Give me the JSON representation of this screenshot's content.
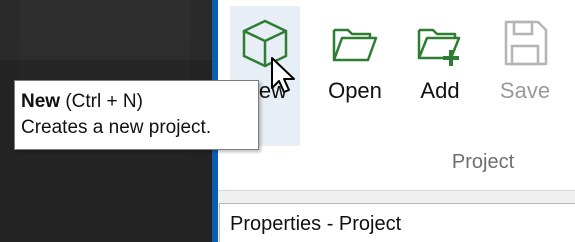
{
  "ribbon": {
    "buttons": [
      {
        "id": "new",
        "label": "New",
        "icon": "new-project-cube-icon"
      },
      {
        "id": "open",
        "label": "Open",
        "icon": "folder-open-icon"
      },
      {
        "id": "add",
        "label": "Add",
        "icon": "folder-add-icon"
      },
      {
        "id": "save",
        "label": "Save",
        "icon": "save-floppy-icon",
        "disabled": true
      }
    ],
    "group_label": "Project"
  },
  "tooltip": {
    "title": "New",
    "shortcut": " (Ctrl + N)",
    "description": "Creates a new project."
  },
  "properties": {
    "header": "Properties - Project"
  },
  "colors": {
    "accent": "#0b5fb3",
    "icon_green": "#2e7d32",
    "disabled_gray": "#9a9a9a",
    "hover_bg": "#e7eef6"
  }
}
